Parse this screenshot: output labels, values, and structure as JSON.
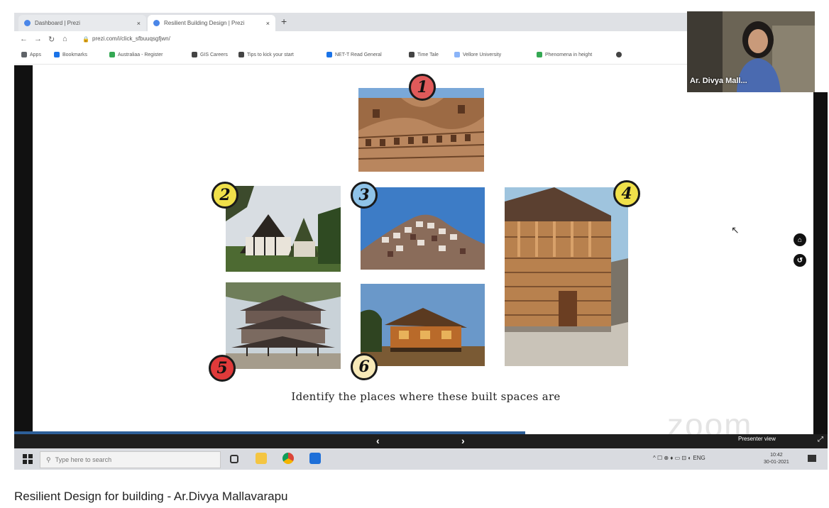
{
  "browser": {
    "tabs": [
      {
        "label": "Dashboard | Prezi",
        "active": false,
        "color": "#4a86e8"
      },
      {
        "label": "Resilient Building Design | Prezi",
        "active": true,
        "color": "#4a86e8"
      }
    ],
    "new_tab_symbol": "+",
    "close_symbol": "×",
    "url": "prezi.com/i/click_sfbuuqsgfjwn/",
    "bookmarks": [
      {
        "label": "Apps",
        "color": "#5f6368"
      },
      {
        "label": "Bookmarks",
        "color": "#1a73e8"
      },
      {
        "label": "Australiaa - Register",
        "color": "#34a853"
      },
      {
        "label": "GIS Careers",
        "color": "#444444"
      },
      {
        "label": "Tips to kick your start",
        "color": "#444444"
      },
      {
        "label": "NET-T Read General",
        "color": "#1a73e8"
      },
      {
        "label": "Time Tale",
        "color": "#444444"
      },
      {
        "label": "Vellore University",
        "color": "#8ab4f8"
      },
      {
        "label": "Phenomena in height",
        "color": "#34a853"
      }
    ]
  },
  "slide": {
    "badges": [
      {
        "number": "1",
        "color": "#e05a5a"
      },
      {
        "number": "2",
        "color": "#f0e04a"
      },
      {
        "number": "3",
        "color": "#8fc3e8"
      },
      {
        "number": "4",
        "color": "#f0e04a"
      },
      {
        "number": "5",
        "color": "#e03a3a"
      },
      {
        "number": "6",
        "color": "#f7e9b8"
      }
    ],
    "caption": "Identify the places where these built spaces are",
    "side_buttons": [
      "home-icon",
      "back-icon"
    ]
  },
  "zoom": {
    "participant_name": "Ar. Divya Mall...",
    "watermark": "zoom",
    "prev_symbol": "‹",
    "next_symbol": "›",
    "presenter_label": "Presenter view"
  },
  "taskbar": {
    "search_placeholder": "Type here to search",
    "tray_text": "^ ☐ ⊕ ♦ ▭ ⊡ ◐ ENG",
    "time": "10:42",
    "date": "30-01-2021"
  },
  "footer_title": "Resilient Design for building - Ar.Divya Mallavarapu"
}
